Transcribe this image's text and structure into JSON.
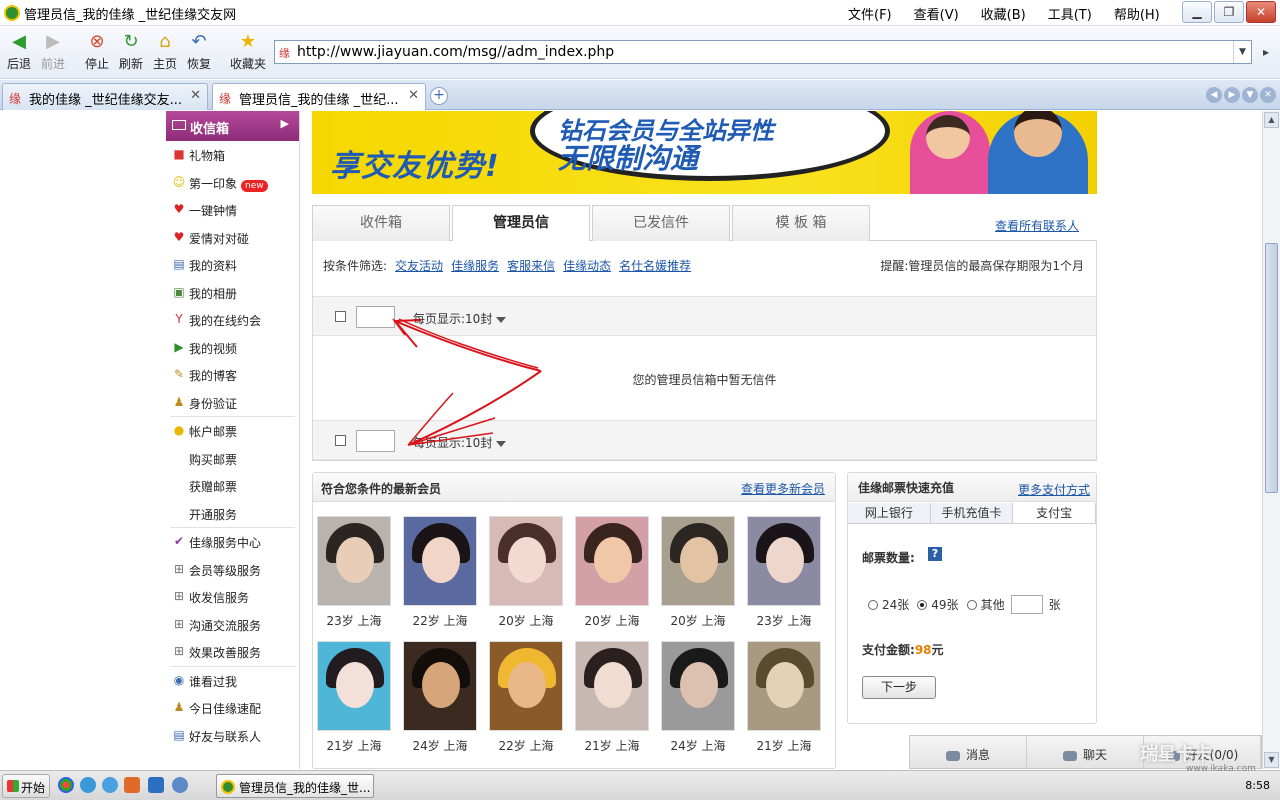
{
  "window": {
    "title": "管理员信_我的佳缘 _世纪佳缘交友网",
    "menu": [
      "文件(F)",
      "查看(V)",
      "收藏(B)",
      "工具(T)",
      "帮助(H)"
    ]
  },
  "toolbar": {
    "back": "后退",
    "forward": "前进",
    "stop": "停止",
    "refresh": "刷新",
    "home": "主页",
    "restore": "恢复",
    "favorites": "收藏夹",
    "url": "http://www.jiayuan.com/msg//adm_index.php"
  },
  "browser_tabs": [
    {
      "label": "我的佳缘 _世纪佳缘交友...",
      "active": false
    },
    {
      "label": "管理员信_我的佳缘 _世纪...",
      "active": true
    }
  ],
  "sidebar": {
    "header": "收信箱",
    "items": [
      {
        "label": "礼物箱",
        "icon": "gift-icon"
      },
      {
        "label": "第一印象",
        "icon": "smiley-icon",
        "badge": "new"
      },
      {
        "label": "一键钟情",
        "icon": "heart-icon"
      },
      {
        "label": "爱情对对碰",
        "icon": "hearts-icon"
      },
      {
        "label": "我的资料",
        "icon": "profile-icon"
      },
      {
        "label": "我的相册",
        "icon": "album-icon"
      },
      {
        "label": "我的在线约会",
        "icon": "cocktail-icon"
      },
      {
        "label": "我的视频",
        "icon": "video-icon"
      },
      {
        "label": "我的博客",
        "icon": "blog-icon"
      },
      {
        "label": "身份验证",
        "icon": "verify-icon"
      }
    ],
    "account": {
      "header": "帐户邮票",
      "items": [
        "购买邮票",
        "获赠邮票",
        "开通服务"
      ]
    },
    "services": {
      "header": "佳缘服务中心",
      "items": [
        "会员等级服务",
        "收发信服务",
        "沟通交流服务",
        "效果改善服务"
      ]
    },
    "more": [
      {
        "label": "谁看过我",
        "icon": "eye-icon"
      },
      {
        "label": "今日佳缘速配",
        "icon": "match-icon"
      },
      {
        "label": "好友与联系人",
        "icon": "contacts-icon"
      }
    ]
  },
  "banner": {
    "slogan": "享交友优势!",
    "bubble_line1": "钻石会员与全站异性",
    "bubble_line2": "无限制沟通"
  },
  "mail_tabs": {
    "tabs": [
      "收件箱",
      "管理员信",
      "已发信件",
      "模 板 箱"
    ],
    "active_index": 1,
    "all_contacts": "查看所有联系人"
  },
  "mail": {
    "filter_label": "按条件筛选:",
    "filters": [
      "交友活动",
      "佳缘服务",
      "客服来信",
      "佳缘动态",
      "名仕名媛推荐"
    ],
    "notice": "提醒:管理员信的最高保存期限为1个月",
    "per_page": "每页显示:10封",
    "empty": "您的管理员信箱中暂无信件"
  },
  "members": {
    "title": "符合您条件的最新会员",
    "more": "查看更多新会员",
    "list": [
      {
        "caption": "23岁 上海"
      },
      {
        "caption": "22岁 上海"
      },
      {
        "caption": "20岁 上海"
      },
      {
        "caption": "20岁 上海"
      },
      {
        "caption": "20岁 上海"
      },
      {
        "caption": "23岁 上海"
      },
      {
        "caption": "21岁 上海"
      },
      {
        "caption": "24岁 上海"
      },
      {
        "caption": "22岁 上海"
      },
      {
        "caption": "21岁 上海"
      },
      {
        "caption": "24岁 上海"
      },
      {
        "caption": "21岁 上海"
      }
    ]
  },
  "recharge": {
    "title": "佳缘邮票快速充值",
    "more": "更多支付方式",
    "pay_tabs": [
      "网上银行",
      "手机充值卡",
      "支付宝"
    ],
    "active_pay_tab": 2,
    "qty_label": "邮票数量:",
    "help": "?",
    "options": [
      "24张",
      "49张",
      "其他"
    ],
    "selected_option": 1,
    "unit": "张",
    "amount_label": "支付金额:",
    "amount_value": "98",
    "amount_unit": "元",
    "next": "下一步"
  },
  "chatbar": {
    "messages": "消息",
    "chat": "聊天",
    "friends": "好友(0/0)"
  },
  "taskbar": {
    "start": "开始",
    "task": "管理员信_我的佳缘_世...",
    "clock": "8:58"
  },
  "watermark": {
    "text": "瑞星卡卡",
    "site": "www.ikaka.com"
  },
  "colors": {
    "sidebar_header": "#9b3387",
    "link": "#1c56a8",
    "banner": "#f6d700",
    "arrow": "#d9141b",
    "amount": "#e88000"
  }
}
